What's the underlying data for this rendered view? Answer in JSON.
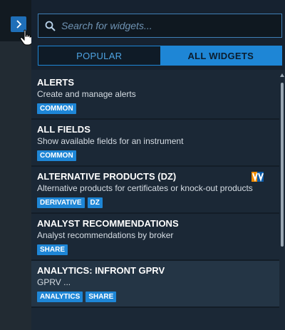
{
  "search": {
    "placeholder": "Search for widgets..."
  },
  "tabs": [
    {
      "label": "POPULAR",
      "active": false
    },
    {
      "label": "ALL WIDGETS",
      "active": true
    }
  ],
  "widgets": [
    {
      "name": "ALERTS",
      "description": "Create and manage alerts",
      "tags": [
        "COMMON"
      ]
    },
    {
      "name": "ALL FIELDS",
      "description": "Show available fields for an instrument",
      "tags": [
        "COMMON"
      ]
    },
    {
      "name": "ALTERNATIVE PRODUCTS (DZ)",
      "description": "Alternative products for certificates or knock-out products",
      "tags": [
        "DERIVATIVE",
        "DZ"
      ],
      "brand_icon": "volksbank-logo-icon"
    },
    {
      "name": "ANALYST RECOMMENDATIONS",
      "description": "Analyst recommendations by broker",
      "tags": [
        "SHARE"
      ]
    },
    {
      "name": "ANALYTICS: INFRONT GPRV",
      "description": "GPRV ...",
      "tags": [
        "ANALYTICS",
        "SHARE"
      ]
    }
  ],
  "colors": {
    "accent": "#1e86d6",
    "panel": "#1b2836",
    "rail": "#222b33"
  },
  "icons": {
    "expand": "chevron-right-icon",
    "search": "search-icon",
    "cursor": "hand-pointer-icon"
  }
}
